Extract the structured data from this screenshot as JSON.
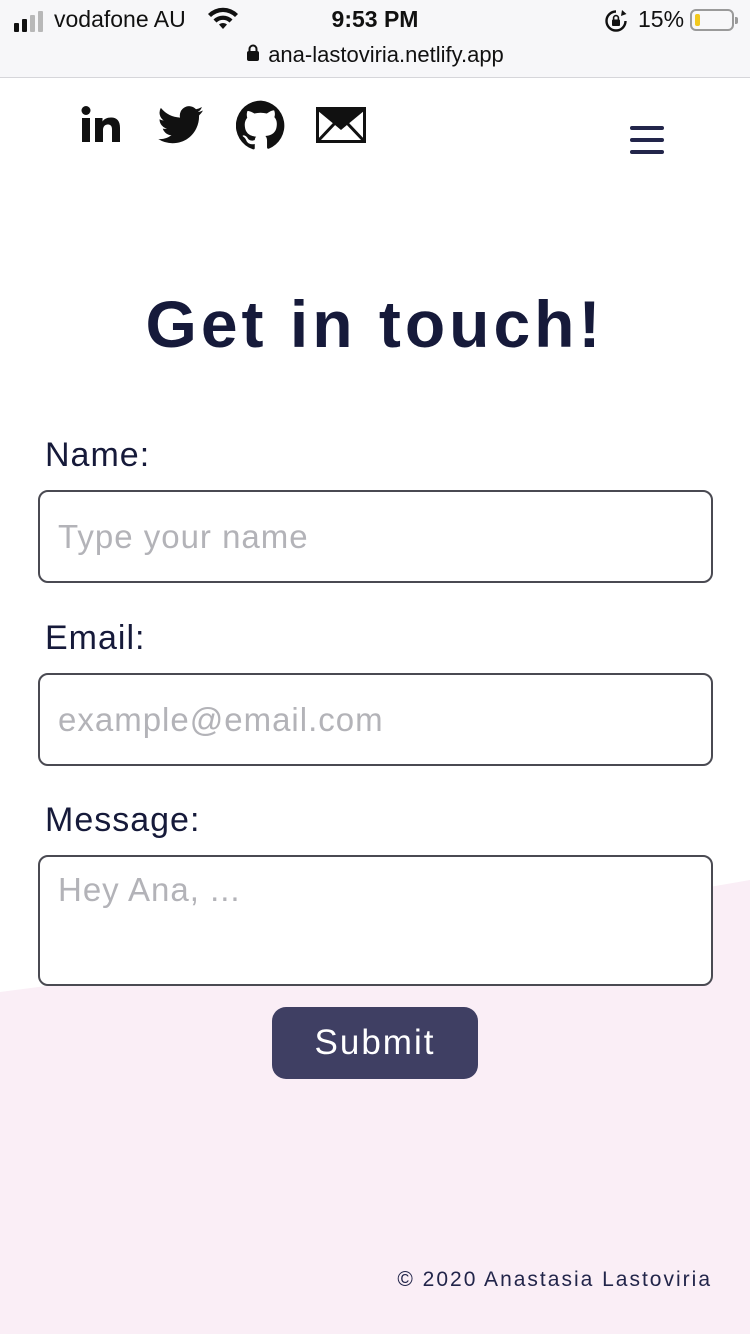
{
  "status_bar": {
    "carrier": "vodafone AU",
    "time": "9:53 PM",
    "battery_percent": "15%",
    "battery_level": 0.15,
    "url": "ana-lastoviria.netlify.app"
  },
  "nav": {
    "social_icons": [
      "linkedin-icon",
      "twitter-icon",
      "github-icon",
      "mail-icon"
    ],
    "menu_icon": "hamburger-menu-icon"
  },
  "page": {
    "title": "Get in touch!"
  },
  "form": {
    "name_label": "Name:",
    "name_placeholder": "Type your name",
    "email_label": "Email:",
    "email_placeholder": "example@email.com",
    "message_label": "Message:",
    "message_placeholder": "Hey Ana, ...",
    "submit_label": "Submit"
  },
  "footer": {
    "copyright": "© 2020 Anastasia Lastoviria"
  },
  "colors": {
    "primary_text": "#161a3a",
    "button": "#3f3f63",
    "pink_background": "#faeef6"
  }
}
